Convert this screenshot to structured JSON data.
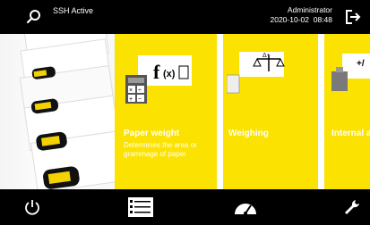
{
  "header": {
    "status": "SSH Active",
    "user": "Administrator",
    "date": "2020-10-02",
    "time": "08:48"
  },
  "tiles": [
    {
      "title": "Paper weight",
      "description": "Determines the area or grammage of paper.",
      "icon": "formula-icon"
    },
    {
      "title": "Weighing",
      "description": "",
      "icon": "balance-icon"
    },
    {
      "title": "Internal a",
      "description": "",
      "icon": "weight-icon"
    }
  ],
  "bottom_nav": [
    "power-icon",
    "task-list-icon",
    "gauge-icon",
    "wrench-icon"
  ],
  "colors": {
    "accent": "#fbe200",
    "bar": "#000000",
    "text": "#ffffff"
  }
}
